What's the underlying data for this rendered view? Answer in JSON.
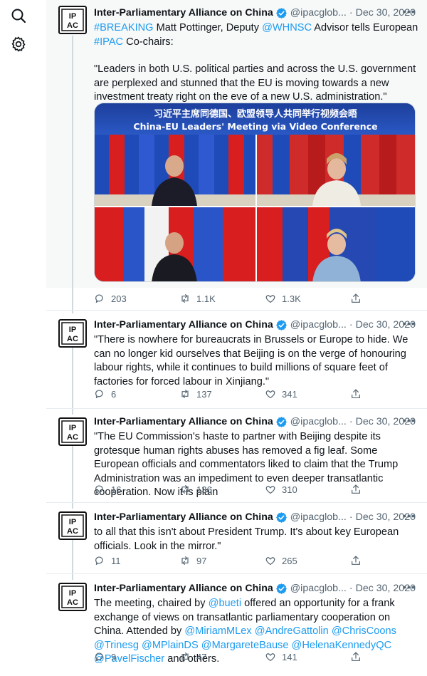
{
  "sidebar": {
    "icons": [
      "search-icon",
      "settings-gear-icon"
    ]
  },
  "account": {
    "name": "Inter-Parliamentary Alliance on China",
    "handle": "@ipacglob...",
    "separator": "·",
    "avatar_text": "IPAC"
  },
  "tweets": [
    {
      "date": "Dec 30, 2020",
      "text": {
        "line1_hashtag": "#BREAKING",
        "line1_a": " Matt Pottinger, Deputy ",
        "line1_mention": "@WHNSC",
        "line1_b": " Advisor tells European ",
        "line1_hashtag2": "#IPAC",
        "line1_c": " Co-chairs:",
        "quote": "\"Leaders in both U.S. political parties and across the U.S. government are perplexed and stunned that the EU is moving towards a new investment treaty right on the eve of a new U.S. administration.\""
      },
      "media": {
        "caption_cn": "习近平主席同德国、欧盟领导人共同举行视频会晤",
        "caption_en": "China-EU Leaders' Meeting via Video Conference"
      },
      "stats": {
        "replies": "203",
        "retweets": "1.1K",
        "likes": "1.3K"
      }
    },
    {
      "date": "Dec 30, 2020",
      "text": "\"There is nowhere for bureaucrats in Brussels or Europe to hide. We can no longer kid ourselves that Beijing is on the verge of honouring labour rights, while it continues to build millions of square feet of factories for forced labour in Xinjiang.\"",
      "stats": {
        "replies": "6",
        "retweets": "137",
        "likes": "341"
      }
    },
    {
      "date": "Dec 30, 2020",
      "text": "\"The EU Commission's haste to partner with Beijing despite its grotesque human rights abuses has removed a fig leaf. Some European officials and commentators liked to claim that the Trump Administration was an impediment to even deeper transatlantic cooperation.  Now it is plain",
      "stats": {
        "replies": "16",
        "retweets": "136",
        "likes": "310"
      }
    },
    {
      "date": "Dec 30, 2020",
      "text": "to all that this isn't about President Trump. It's about key European officials. Look in the mirror.\"",
      "stats": {
        "replies": "11",
        "retweets": "97",
        "likes": "265"
      }
    },
    {
      "date": "Dec 30, 2020",
      "text": {
        "a": "The meeting, chaired by ",
        "m1": "@bueti",
        "b": " offered an opportunity for a frank exchange of views on transatlantic parliamentary cooperation on China. Attended by ",
        "m2": "@MiriamMLex",
        "m3": "@AndreGattolin",
        "m4": "@ChrisCoons",
        "m5": "@Trinesg",
        "m6": "@MPlainDS",
        "m7": "@MargareteBause",
        "m8": "@HelenaKennedyQC",
        "m9": "@PavelFischer",
        "c": " and others."
      },
      "stats": {
        "replies": "9",
        "retweets": "47",
        "likes": "141"
      }
    }
  ],
  "colors": {
    "link": "#1d9bf0",
    "verified": "#1d9bf0",
    "muted": "#536471",
    "text": "#0f1419"
  }
}
